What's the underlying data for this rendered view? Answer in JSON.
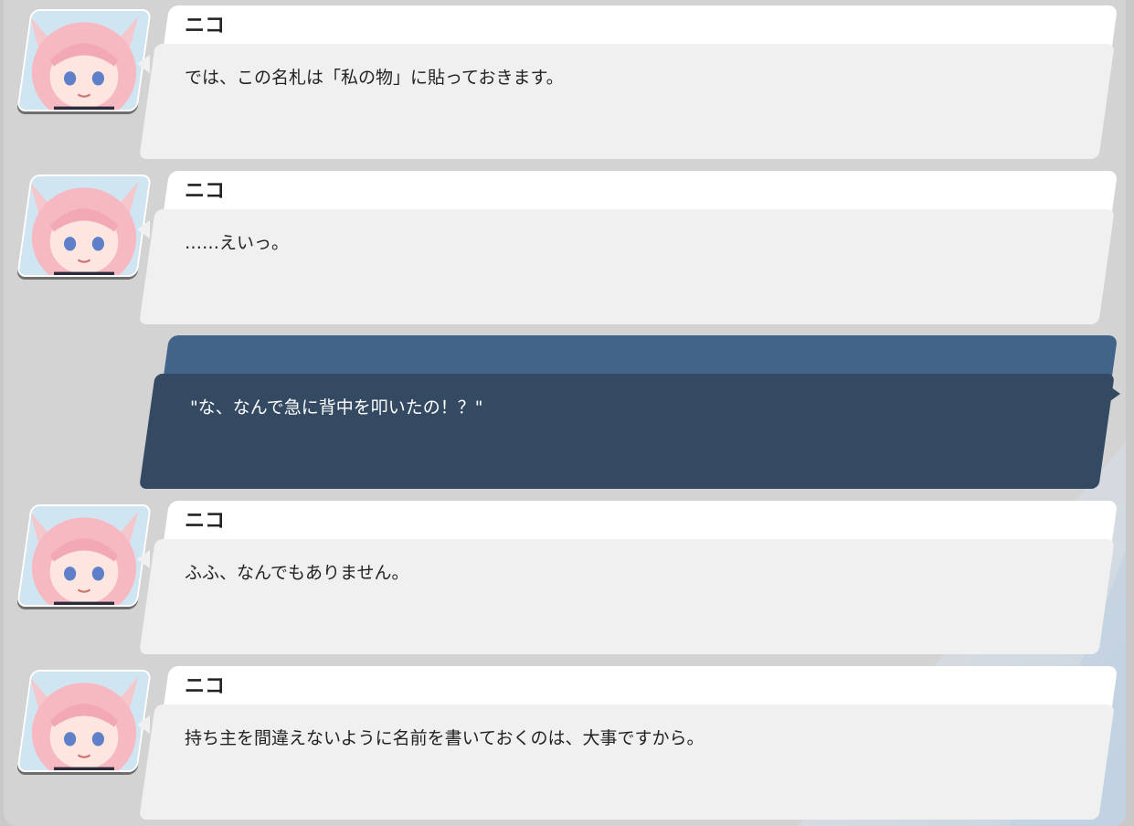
{
  "backlog": [
    {
      "speaker": "ニコ",
      "text": "では、この名札は「私の物」に貼っておきます。",
      "is_player": false
    },
    {
      "speaker": "ニコ",
      "text": "……えいっ。",
      "is_player": false
    },
    {
      "speaker": "",
      "text": "\"な、なんで急に背中を叩いたの！？\"",
      "is_player": true
    },
    {
      "speaker": "ニコ",
      "text": "ふふ、なんでもありません。",
      "is_player": false
    },
    {
      "speaker": "ニコ",
      "text": "持ち主を間違えないように名前を書いておくのは、大事ですから。",
      "is_player": false
    }
  ],
  "colors": {
    "panel_bg": "#d3d3d3",
    "npc_name_bar": "#ffffff",
    "npc_bubble": "#f0f0f0",
    "player_header": "#416488",
    "player_bubble": "#344962",
    "text_dark": "#222222",
    "text_light": "#ffffff"
  },
  "icons": {
    "avatar": "character-portrait-niko"
  }
}
